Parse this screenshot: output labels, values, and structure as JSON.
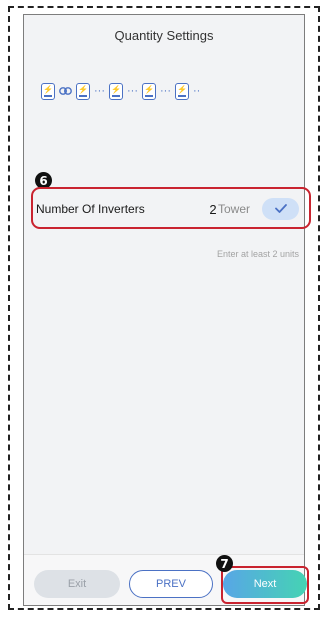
{
  "screen": {
    "title": "Quantity Settings"
  },
  "diagram": {
    "icons": [
      "inverter-icon",
      "link-icon",
      "ellipsis-icon"
    ],
    "color": "#4b71c4"
  },
  "markers": {
    "step_6": "6",
    "step_7": "7"
  },
  "inverters": {
    "label": "Number Of Inverters",
    "value": "2",
    "unit": "Tower",
    "hint": "Enter at least 2 units"
  },
  "buttons": {
    "exit": "Exit",
    "prev": "PREV",
    "next": "Next"
  },
  "colors": {
    "accent": "#4b71c4",
    "highlight": "#c9232f",
    "next_gradient_start": "#58a6e6",
    "next_gradient_end": "#45d3b3"
  }
}
